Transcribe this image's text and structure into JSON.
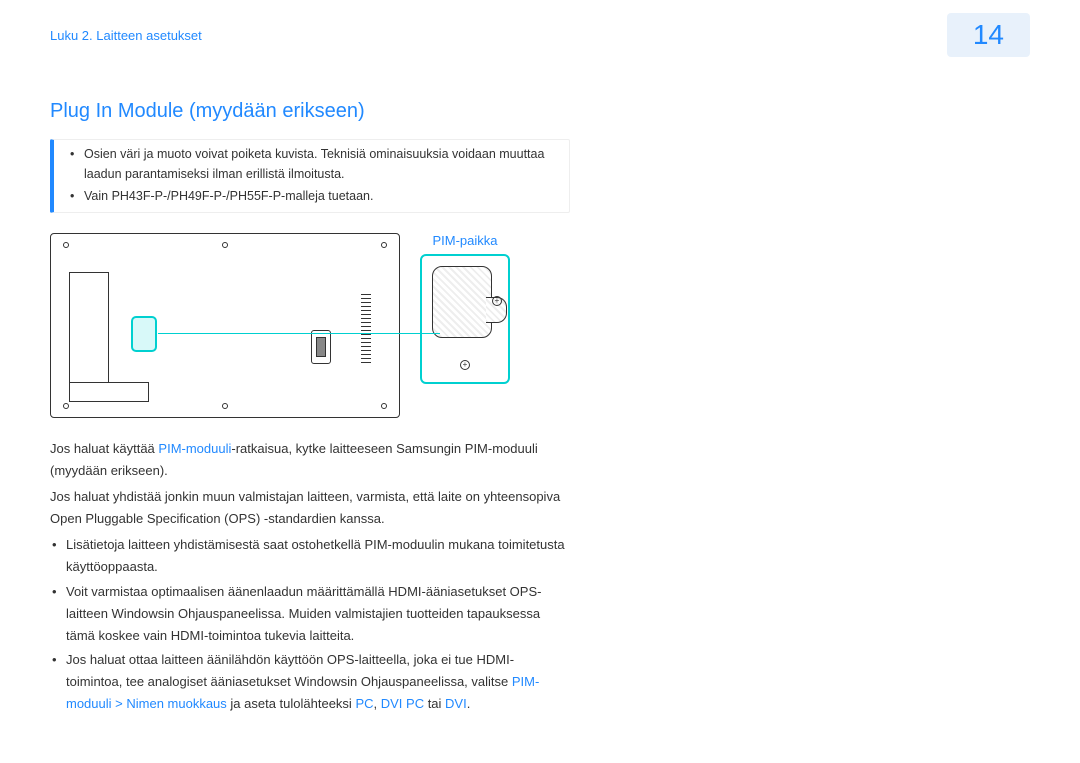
{
  "header": {
    "chapter": "Luku 2. Laitteen asetukset",
    "page_number": "14"
  },
  "section": {
    "title": "Plug In Module (myydään erikseen)"
  },
  "note": {
    "item1": "Osien väri ja muoto voivat poiketa kuvista. Teknisiä ominaisuuksia voidaan muuttaa laadun parantamiseksi ilman erillistä ilmoitusta.",
    "item2": "Vain PH43F-P-/PH49F-P-/PH55F-P-malleja tuetaan."
  },
  "diagram": {
    "detail_label": "PIM-paikka"
  },
  "para1": {
    "pre": "Jos haluat käyttää ",
    "hl": "PIM-moduuli",
    "post": "-ratkaisua, kytke laitteeseen Samsungin PIM-moduuli (myydään erikseen)."
  },
  "para2": "Jos haluat yhdistää jonkin muun valmistajan laitteen, varmista, että laite on yhteensopiva Open Pluggable Specification (OPS) -standardien kanssa.",
  "list": {
    "i1": "Lisätietoja laitteen yhdistämisestä saat ostohetkellä PIM-moduulin mukana toimitetusta käyttöoppaasta.",
    "i2": "Voit varmistaa optimaalisen äänenlaadun määrittämällä HDMI-ääniasetukset OPS-laitteen Windowsin Ohjauspaneelissa. Muiden valmistajien tuotteiden tapauksessa tämä koskee vain HDMI-toimintoa tukevia laitteita.",
    "i3_pre": "Jos haluat ottaa laitteen äänilähdön käyttöön OPS-laitteella, joka ei tue HDMI-toimintoa, tee analogiset ääniasetukset Windowsin Ohjauspaneelissa, valitse ",
    "i3_hl1": "PIM-moduuli",
    "i3_sep": " > ",
    "i3_hl2": "Nimen muokkaus",
    "i3_mid": " ja aseta tulolähteeksi ",
    "i3_pc": "PC",
    "i3_c1": ", ",
    "i3_dvipc": "DVI PC",
    "i3_c2": " tai ",
    "i3_dvi": "DVI",
    "i3_end": "."
  }
}
